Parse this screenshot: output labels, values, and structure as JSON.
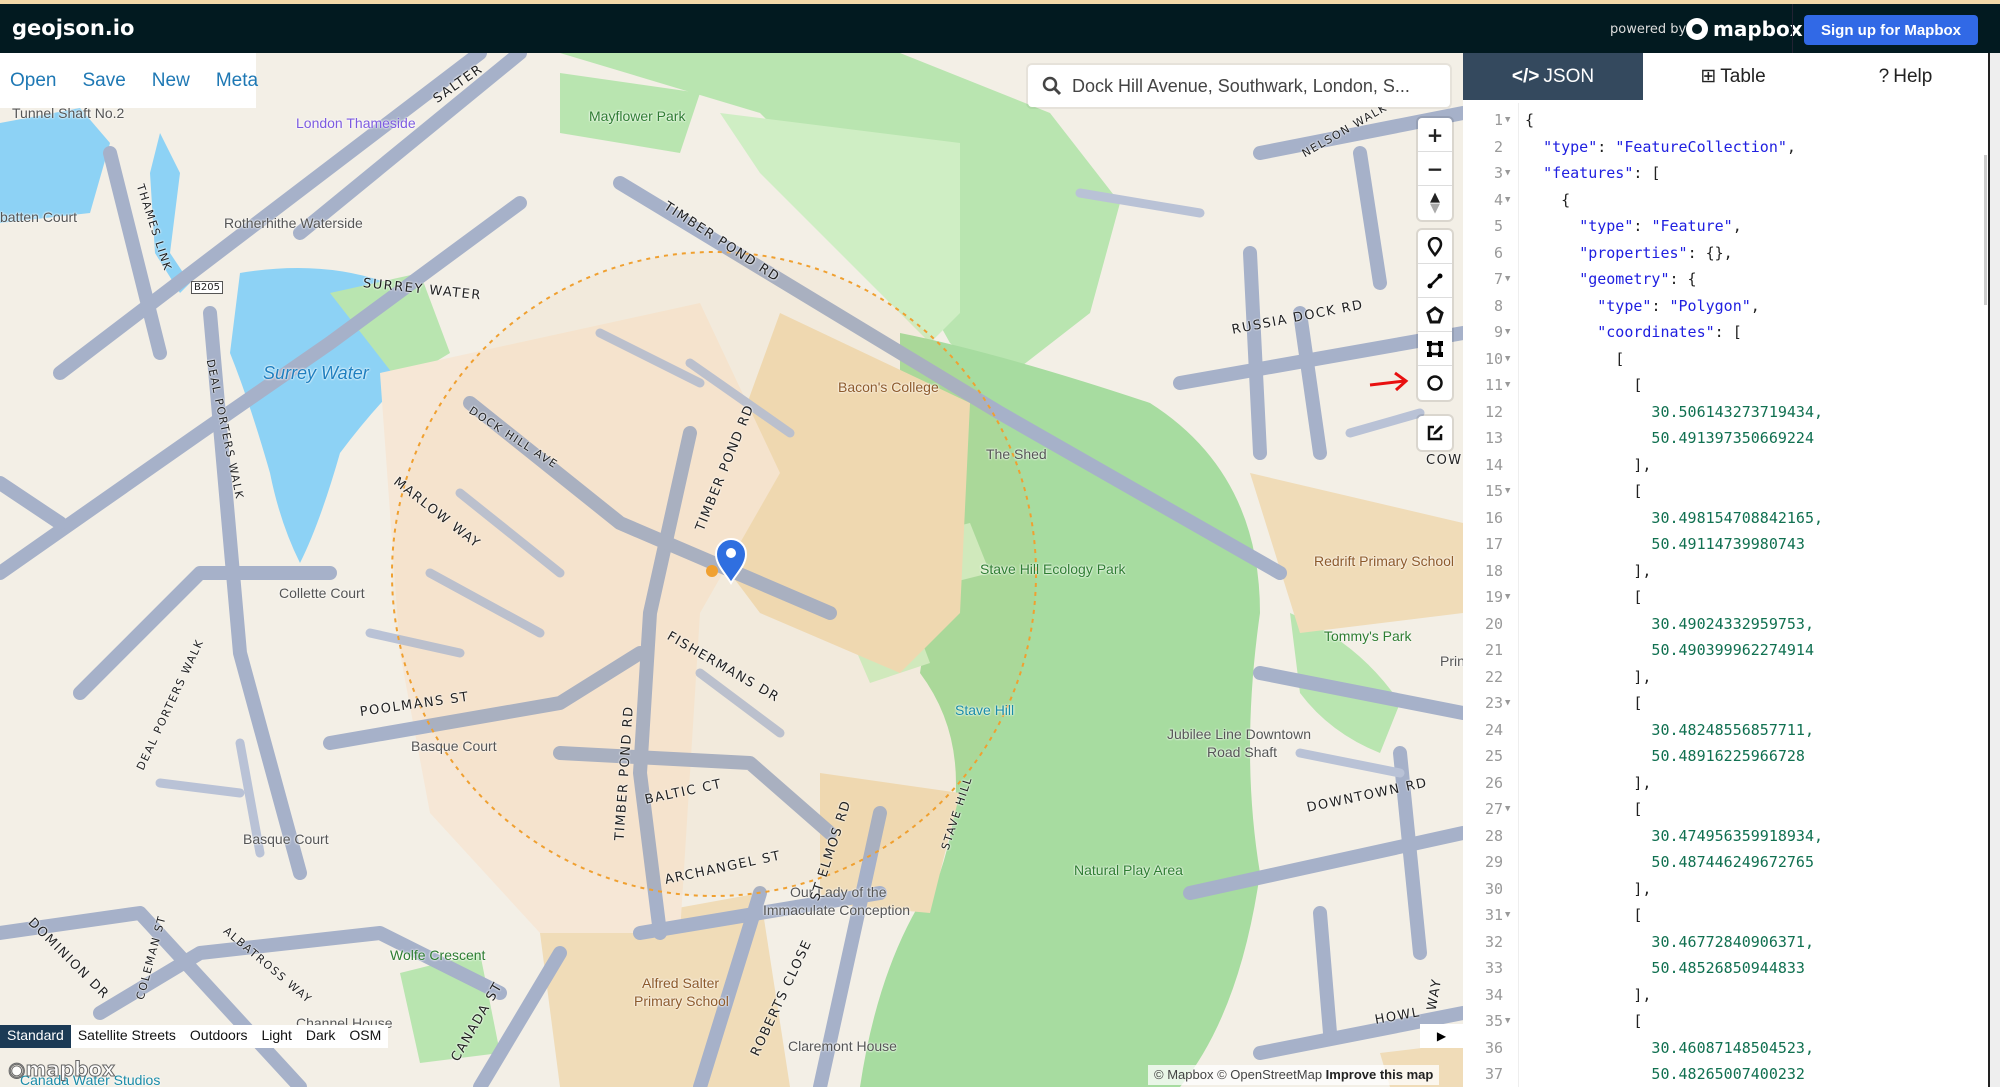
{
  "header": {
    "logo": "geojson.io",
    "powered_by": "powered by",
    "mapbox_brand": "mapbox",
    "signup_label": "Sign up for Mapbox"
  },
  "file_menu": [
    "Open",
    "Save",
    "New",
    "Meta"
  ],
  "search": {
    "value": "Dock Hill Avenue, Southwark, London, S..."
  },
  "map_controls": {
    "zoom_in": "+",
    "zoom_out": "−",
    "compass": "▲"
  },
  "draw_tools": [
    "marker",
    "line",
    "polygon",
    "rectangle",
    "circle"
  ],
  "edit_tool": "edit",
  "styles": {
    "items": [
      "Standard",
      "Satellite Streets",
      "Outdoors",
      "Light",
      "Dark",
      "OSM"
    ],
    "active": "Standard"
  },
  "attribution": {
    "mapbox": "© Mapbox",
    "osm": "© OpenStreetMap",
    "improve": "Improve this map",
    "watermark": "mapbox"
  },
  "map": {
    "places": [
      "Tunnel Shaft No.2",
      "London Thameside",
      "Mayflower Park",
      "Rotherhithe Waterside",
      "Surrey Water",
      "Bacon's College",
      "The Shed",
      "Stave Hill Ecology Park",
      "Redrift Primary School",
      "Tommy's Park",
      "Collette Court",
      "Stave Hill",
      "Jubilee Line Downtown",
      "Road Shaft",
      "Basque Court",
      "Basque Court",
      "Our Lady of the",
      "Immaculate Conception",
      "Natural Play Area",
      "Wolfe Crescent",
      "Alfred Salter",
      "Primary School",
      "Channel House",
      "Claremont House",
      "Canada Water Studios",
      "batten Court",
      "Prin"
    ],
    "roads": [
      "SALTER",
      "TIMBER POND RD",
      "SURREY WATER",
      "DOCK HILL AVE",
      "MARLOW WAY",
      "TIMBER POND RD",
      "FISHERMANS DR",
      "POOLMANS ST",
      "TIMBER POND RD",
      "BALTIC CT",
      "ARCHANGEL ST",
      "ST ELMOS RD",
      "STAVE HILL",
      "ROBERTS CLOSE",
      "RUSSIA DOCK RD",
      "NELSON WALK",
      "DOWNTOWN RD",
      "DEAL PORTERS WALK",
      "DEAL PORTERS WALK",
      "THAMES LINK",
      "B205",
      "CANADA ST",
      "DOMINION DR",
      "ALBATROSS WAY",
      "COLEMAN ST",
      "HOWL",
      "COW",
      "WAY"
    ],
    "colors": {
      "land": "#f3efe6",
      "park": "#b9e5b0",
      "water": "#8dd2f5",
      "road": "#a6b1c9",
      "circle": "#f0a030",
      "marker": "#2f6fe0"
    }
  },
  "panel": {
    "tabs": [
      {
        "icon": "code-icon",
        "label": "JSON",
        "active": true
      },
      {
        "icon": "table-icon",
        "label": "Table"
      },
      {
        "icon": "help-icon",
        "label": "Help"
      }
    ],
    "code_lines": [
      "{",
      "  \"type\": \"FeatureCollection\",",
      "  \"features\": [",
      "    {",
      "      \"type\": \"Feature\",",
      "      \"properties\": {},",
      "      \"geometry\": {",
      "        \"type\": \"Polygon\",",
      "        \"coordinates\": [",
      "          [",
      "            [",
      "              30.506143273719434,",
      "              50.491397350669224",
      "            ],",
      "            [",
      "              30.498154708842165,",
      "              50.49114739980743",
      "            ],",
      "            [",
      "              30.49024332959753,",
      "              50.490399962274914",
      "            ],",
      "            [",
      "              30.48248556857711,",
      "              50.48916225966728",
      "            ],",
      "            [",
      "              30.474956359918934,",
      "              50.487446249672765",
      "            ],",
      "            [",
      "              30.46772840906371,",
      "              50.48526850944833",
      "            ],",
      "            [",
      "              30.46087148504523,",
      "              50.48265007400232"
    ],
    "foldable_lines": [
      1,
      3,
      4,
      7,
      9,
      10,
      11,
      15,
      19,
      23,
      27,
      31,
      35
    ]
  }
}
